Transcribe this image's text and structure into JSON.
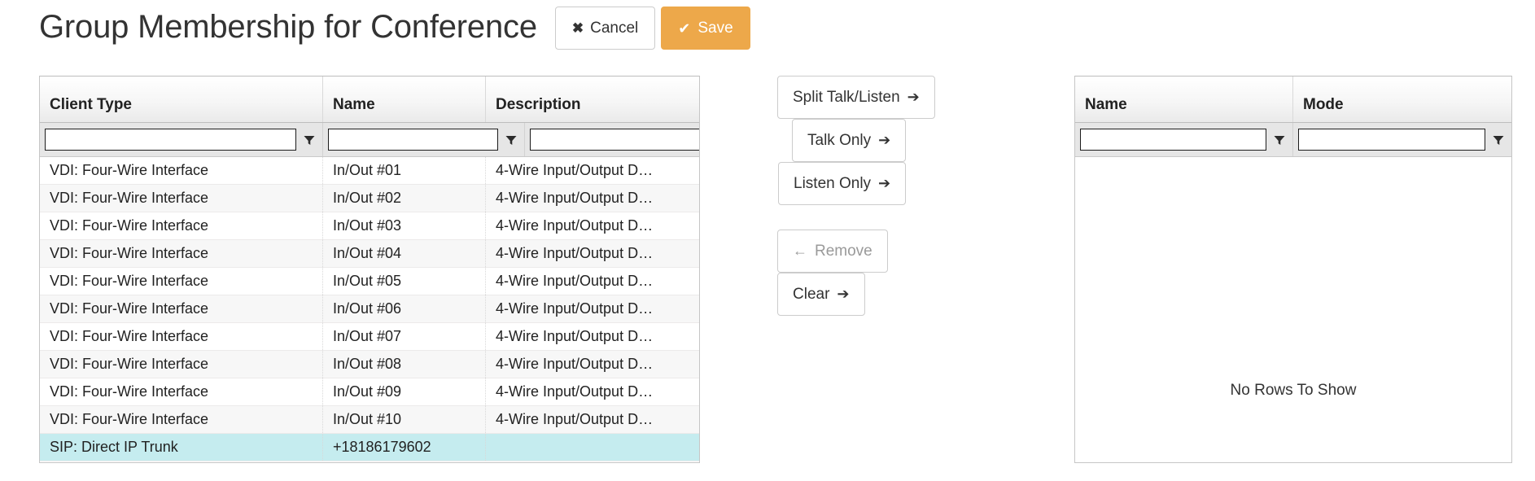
{
  "header": {
    "title": "Group Membership for Conference",
    "cancel_label": "Cancel",
    "cancel_glyph": "✖",
    "save_label": "Save",
    "save_glyph": "✔",
    "save_color": "#eda84a"
  },
  "left_grid": {
    "columns": [
      "Client Type",
      "Name",
      "Description"
    ],
    "filters": {
      "client_type": "",
      "name": "",
      "description": "",
      "placeholder": ""
    },
    "filter_icon": "funnel-icon",
    "rows": [
      {
        "client_type": "VDI: Four-Wire Interface",
        "name": "In/Out #01",
        "description": "4-Wire Input/Output D…",
        "selected": false
      },
      {
        "client_type": "VDI: Four-Wire Interface",
        "name": "In/Out #02",
        "description": "4-Wire Input/Output D…",
        "selected": false
      },
      {
        "client_type": "VDI: Four-Wire Interface",
        "name": "In/Out #03",
        "description": "4-Wire Input/Output D…",
        "selected": false
      },
      {
        "client_type": "VDI: Four-Wire Interface",
        "name": "In/Out #04",
        "description": "4-Wire Input/Output D…",
        "selected": false
      },
      {
        "client_type": "VDI: Four-Wire Interface",
        "name": "In/Out #05",
        "description": "4-Wire Input/Output D…",
        "selected": false
      },
      {
        "client_type": "VDI: Four-Wire Interface",
        "name": "In/Out #06",
        "description": "4-Wire Input/Output D…",
        "selected": false
      },
      {
        "client_type": "VDI: Four-Wire Interface",
        "name": "In/Out #07",
        "description": "4-Wire Input/Output D…",
        "selected": false
      },
      {
        "client_type": "VDI: Four-Wire Interface",
        "name": "In/Out #08",
        "description": "4-Wire Input/Output D…",
        "selected": false
      },
      {
        "client_type": "VDI: Four-Wire Interface",
        "name": "In/Out #09",
        "description": "4-Wire Input/Output D…",
        "selected": false
      },
      {
        "client_type": "VDI: Four-Wire Interface",
        "name": "In/Out #10",
        "description": "4-Wire Input/Output D…",
        "selected": false
      },
      {
        "client_type": "SIP: Direct IP Trunk",
        "name": "+18186179602",
        "description": "",
        "selected": true
      }
    ],
    "selected_row_color": "#c5ecef"
  },
  "middle_buttons": [
    {
      "label": "Split Talk/Listen",
      "glyph": "➔",
      "disabled": false
    },
    {
      "label": "Talk Only",
      "glyph": "➔",
      "disabled": false
    },
    {
      "label": "Listen Only",
      "glyph": "➔",
      "disabled": false
    },
    {
      "label": "Remove",
      "glyph": "←",
      "disabled": true,
      "glyph_first": true
    },
    {
      "label": "Clear",
      "glyph": "➔",
      "disabled": false
    }
  ],
  "right_grid": {
    "columns": [
      "Name",
      "Mode"
    ],
    "filters": {
      "name": "",
      "mode": "",
      "placeholder": ""
    },
    "filter_icon": "funnel-icon",
    "empty_message": "No Rows To Show",
    "rows": []
  }
}
